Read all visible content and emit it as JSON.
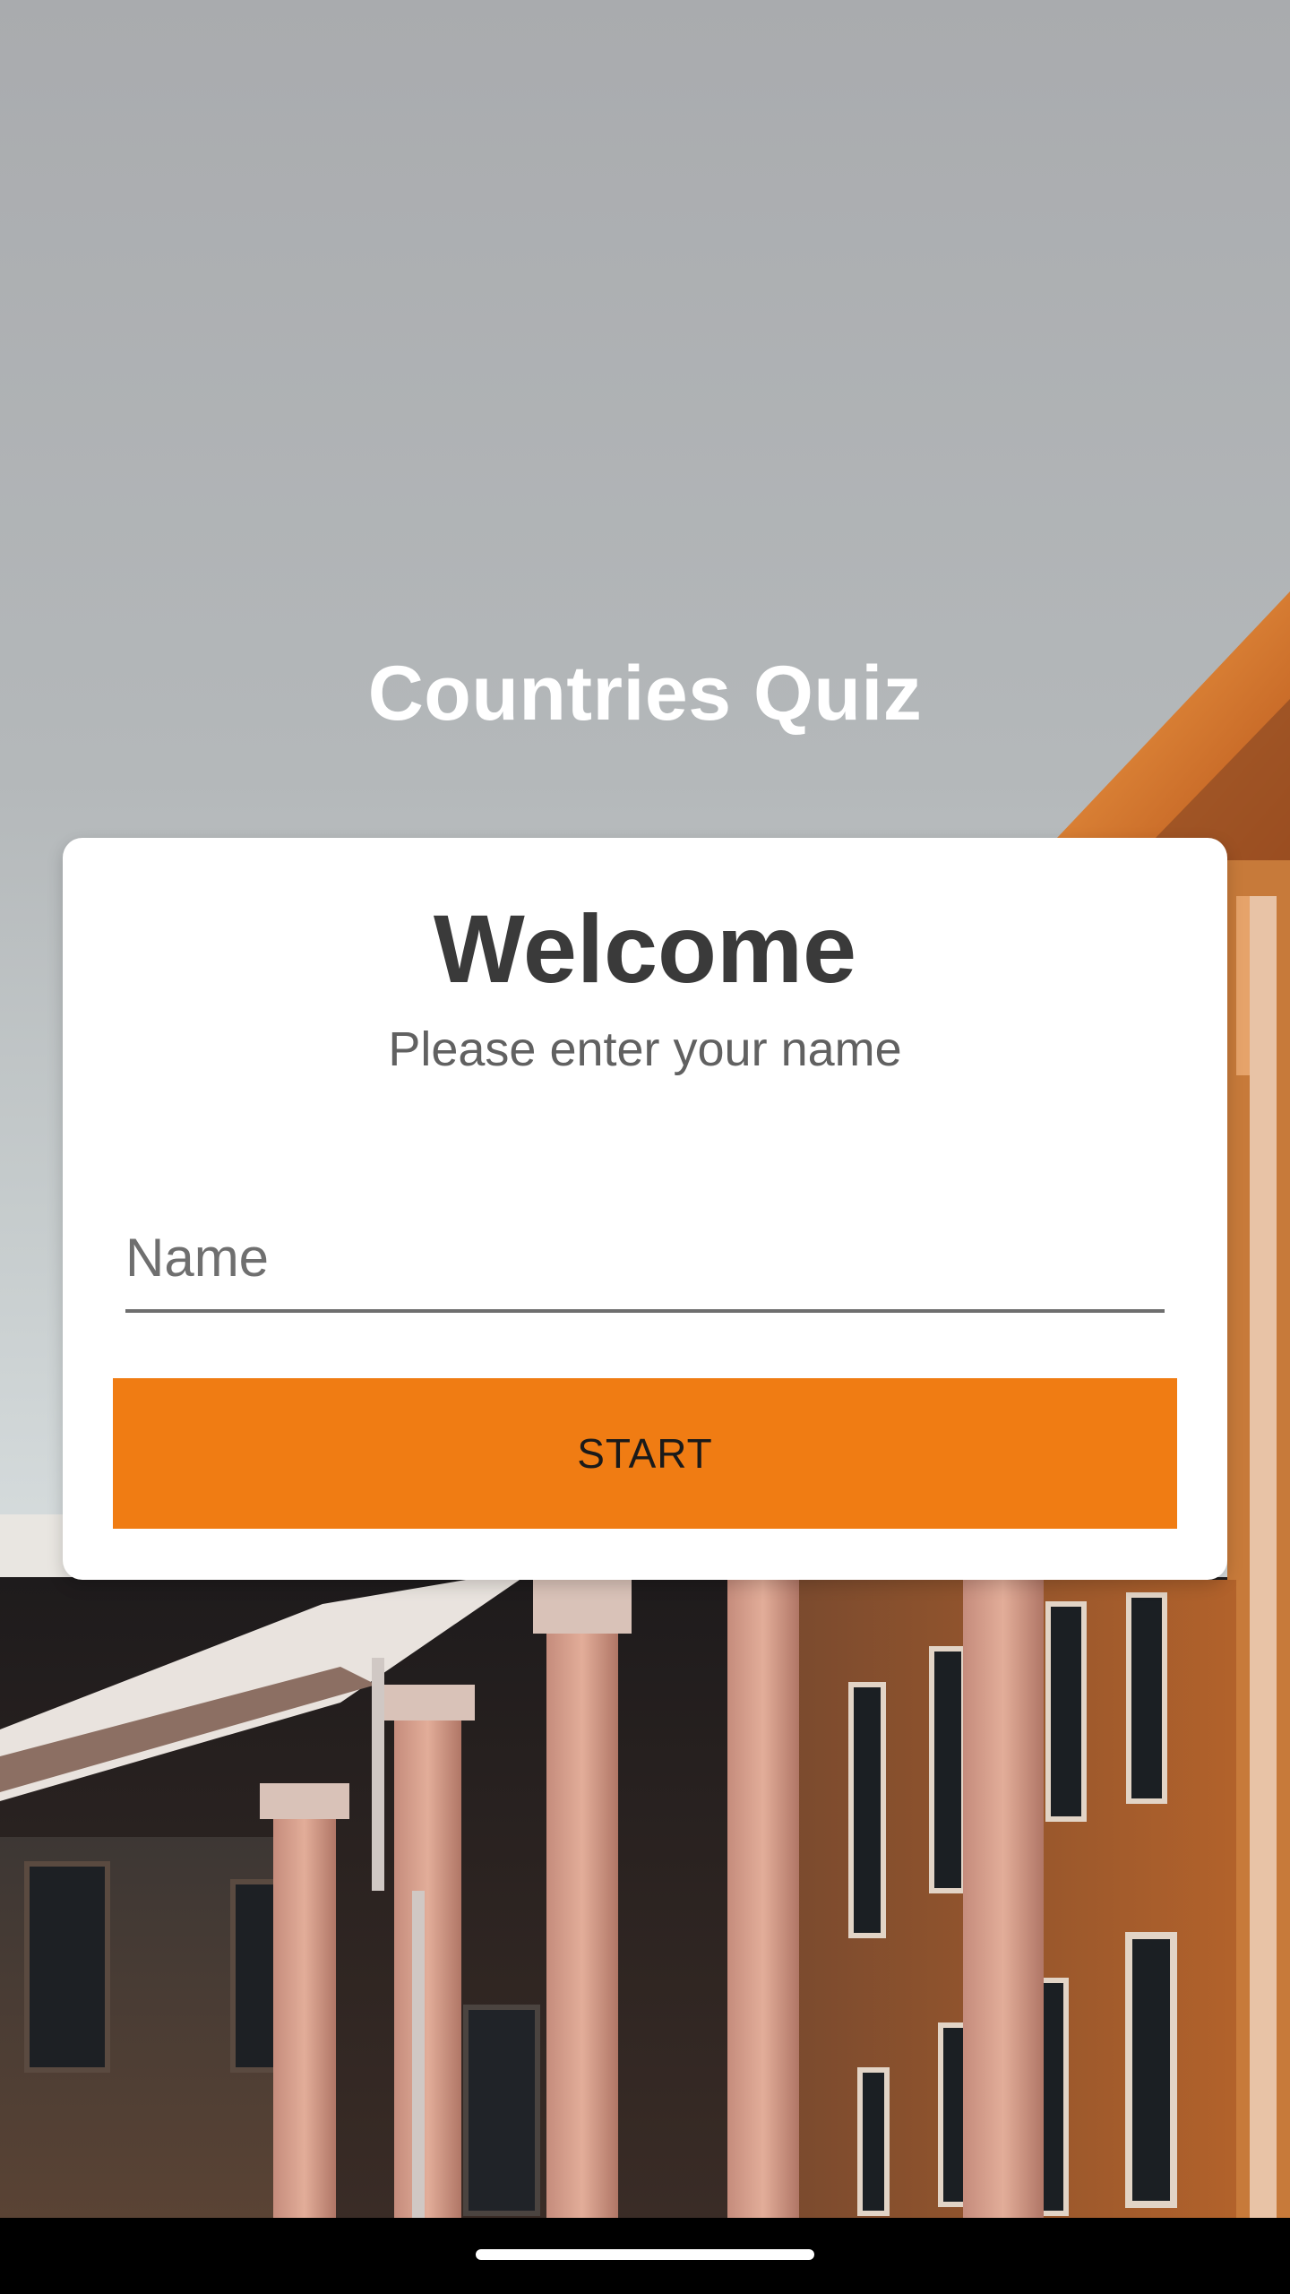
{
  "app": {
    "title": "Countries Quiz"
  },
  "card": {
    "heading": "Welcome",
    "subtitle": "Please enter your name",
    "name_field": {
      "placeholder": "Name",
      "value": ""
    },
    "start_label": "START"
  },
  "colors": {
    "accent": "#f07c13",
    "card_bg": "#ffffff",
    "heading_text": "#3a3a3a",
    "subtitle_text": "#616161",
    "nav_bar": "#000000"
  },
  "background": {
    "description_icon": "building-photo"
  }
}
